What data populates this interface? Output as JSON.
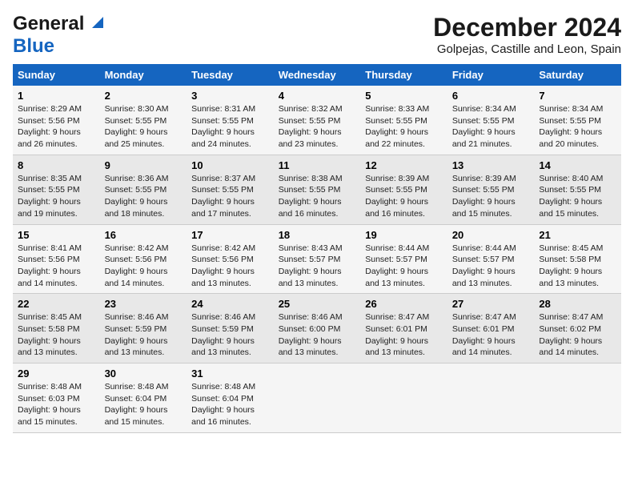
{
  "logo": {
    "line1": "General",
    "line2": "Blue"
  },
  "title": "December 2024",
  "subtitle": "Golpejas, Castille and Leon, Spain",
  "days_of_week": [
    "Sunday",
    "Monday",
    "Tuesday",
    "Wednesday",
    "Thursday",
    "Friday",
    "Saturday"
  ],
  "weeks": [
    [
      {
        "day": "1",
        "sunrise": "8:29 AM",
        "sunset": "5:56 PM",
        "daylight": "9 hours and 26 minutes."
      },
      {
        "day": "2",
        "sunrise": "8:30 AM",
        "sunset": "5:55 PM",
        "daylight": "9 hours and 25 minutes."
      },
      {
        "day": "3",
        "sunrise": "8:31 AM",
        "sunset": "5:55 PM",
        "daylight": "9 hours and 24 minutes."
      },
      {
        "day": "4",
        "sunrise": "8:32 AM",
        "sunset": "5:55 PM",
        "daylight": "9 hours and 23 minutes."
      },
      {
        "day": "5",
        "sunrise": "8:33 AM",
        "sunset": "5:55 PM",
        "daylight": "9 hours and 22 minutes."
      },
      {
        "day": "6",
        "sunrise": "8:34 AM",
        "sunset": "5:55 PM",
        "daylight": "9 hours and 21 minutes."
      },
      {
        "day": "7",
        "sunrise": "8:34 AM",
        "sunset": "5:55 PM",
        "daylight": "9 hours and 20 minutes."
      }
    ],
    [
      {
        "day": "8",
        "sunrise": "8:35 AM",
        "sunset": "5:55 PM",
        "daylight": "9 hours and 19 minutes."
      },
      {
        "day": "9",
        "sunrise": "8:36 AM",
        "sunset": "5:55 PM",
        "daylight": "9 hours and 18 minutes."
      },
      {
        "day": "10",
        "sunrise": "8:37 AM",
        "sunset": "5:55 PM",
        "daylight": "9 hours and 17 minutes."
      },
      {
        "day": "11",
        "sunrise": "8:38 AM",
        "sunset": "5:55 PM",
        "daylight": "9 hours and 16 minutes."
      },
      {
        "day": "12",
        "sunrise": "8:39 AM",
        "sunset": "5:55 PM",
        "daylight": "9 hours and 16 minutes."
      },
      {
        "day": "13",
        "sunrise": "8:39 AM",
        "sunset": "5:55 PM",
        "daylight": "9 hours and 15 minutes."
      },
      {
        "day": "14",
        "sunrise": "8:40 AM",
        "sunset": "5:55 PM",
        "daylight": "9 hours and 15 minutes."
      }
    ],
    [
      {
        "day": "15",
        "sunrise": "8:41 AM",
        "sunset": "5:56 PM",
        "daylight": "9 hours and 14 minutes."
      },
      {
        "day": "16",
        "sunrise": "8:42 AM",
        "sunset": "5:56 PM",
        "daylight": "9 hours and 14 minutes."
      },
      {
        "day": "17",
        "sunrise": "8:42 AM",
        "sunset": "5:56 PM",
        "daylight": "9 hours and 13 minutes."
      },
      {
        "day": "18",
        "sunrise": "8:43 AM",
        "sunset": "5:57 PM",
        "daylight": "9 hours and 13 minutes."
      },
      {
        "day": "19",
        "sunrise": "8:44 AM",
        "sunset": "5:57 PM",
        "daylight": "9 hours and 13 minutes."
      },
      {
        "day": "20",
        "sunrise": "8:44 AM",
        "sunset": "5:57 PM",
        "daylight": "9 hours and 13 minutes."
      },
      {
        "day": "21",
        "sunrise": "8:45 AM",
        "sunset": "5:58 PM",
        "daylight": "9 hours and 13 minutes."
      }
    ],
    [
      {
        "day": "22",
        "sunrise": "8:45 AM",
        "sunset": "5:58 PM",
        "daylight": "9 hours and 13 minutes."
      },
      {
        "day": "23",
        "sunrise": "8:46 AM",
        "sunset": "5:59 PM",
        "daylight": "9 hours and 13 minutes."
      },
      {
        "day": "24",
        "sunrise": "8:46 AM",
        "sunset": "5:59 PM",
        "daylight": "9 hours and 13 minutes."
      },
      {
        "day": "25",
        "sunrise": "8:46 AM",
        "sunset": "6:00 PM",
        "daylight": "9 hours and 13 minutes."
      },
      {
        "day": "26",
        "sunrise": "8:47 AM",
        "sunset": "6:01 PM",
        "daylight": "9 hours and 13 minutes."
      },
      {
        "day": "27",
        "sunrise": "8:47 AM",
        "sunset": "6:01 PM",
        "daylight": "9 hours and 14 minutes."
      },
      {
        "day": "28",
        "sunrise": "8:47 AM",
        "sunset": "6:02 PM",
        "daylight": "9 hours and 14 minutes."
      }
    ],
    [
      {
        "day": "29",
        "sunrise": "8:48 AM",
        "sunset": "6:03 PM",
        "daylight": "9 hours and 15 minutes."
      },
      {
        "day": "30",
        "sunrise": "8:48 AM",
        "sunset": "6:04 PM",
        "daylight": "9 hours and 15 minutes."
      },
      {
        "day": "31",
        "sunrise": "8:48 AM",
        "sunset": "6:04 PM",
        "daylight": "9 hours and 16 minutes."
      },
      null,
      null,
      null,
      null
    ]
  ],
  "labels": {
    "sunrise": "Sunrise:",
    "sunset": "Sunset:",
    "daylight": "Daylight:"
  }
}
